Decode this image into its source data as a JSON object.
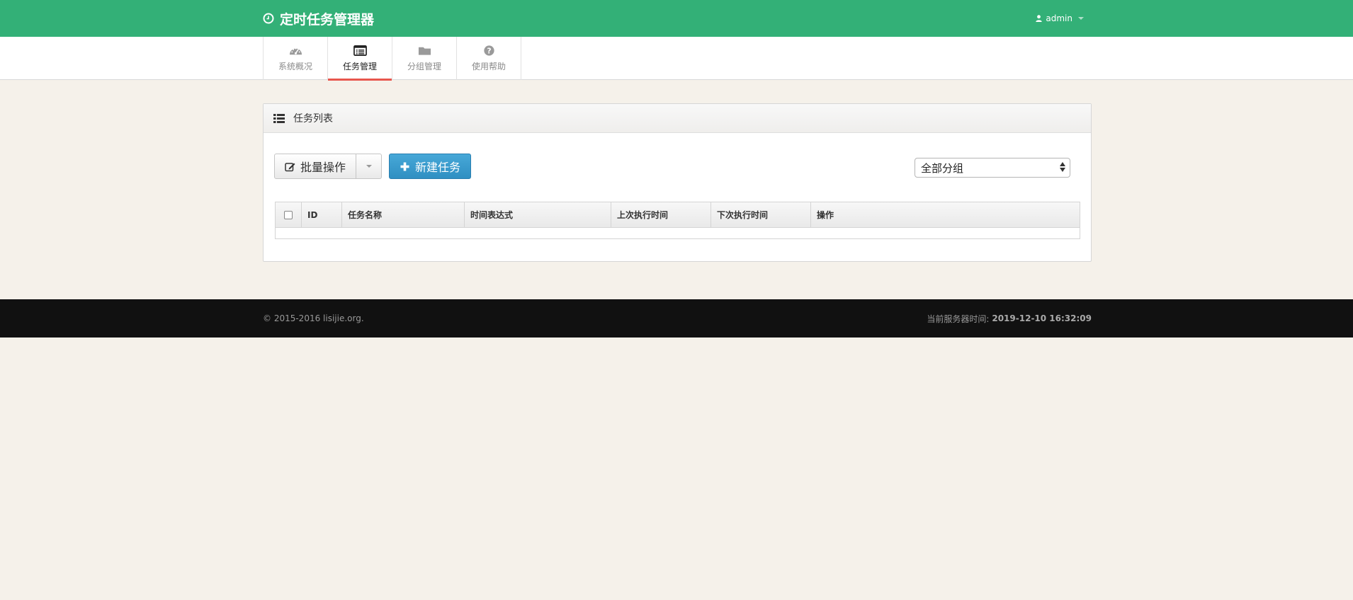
{
  "header": {
    "title": "定时任务管理器",
    "title_icon": "clock-icon",
    "user": "admin",
    "user_icon": "user-icon"
  },
  "nav": {
    "tabs": [
      {
        "label": "系统概况",
        "icon": "dashboard-icon",
        "active": false
      },
      {
        "label": "任务管理",
        "icon": "list-alt-icon",
        "active": true
      },
      {
        "label": "分组管理",
        "icon": "folder-icon",
        "active": false
      },
      {
        "label": "使用帮助",
        "icon": "question-circle-icon",
        "active": false
      }
    ]
  },
  "panel": {
    "title": "任务列表",
    "title_icon": "list-icon",
    "batch_button": "批量操作",
    "new_button": "新建任务",
    "group_select": "全部分组",
    "table": {
      "headers": [
        "ID",
        "任务名称",
        "时间表达式",
        "上次执行时间",
        "下次执行时间",
        "操作"
      ],
      "rows": []
    }
  },
  "footer": {
    "copyright": "© 2015-2016 lisijie.org.",
    "server_time_label": "当前服务器时间:",
    "server_time": "2019-12-10 16:32:09"
  },
  "colors": {
    "header": "#33b077",
    "active_tab_underline": "#e8564d",
    "primary_button": "#3a9bd0",
    "footer": "#111111",
    "page_background": "#f5f1ea"
  }
}
